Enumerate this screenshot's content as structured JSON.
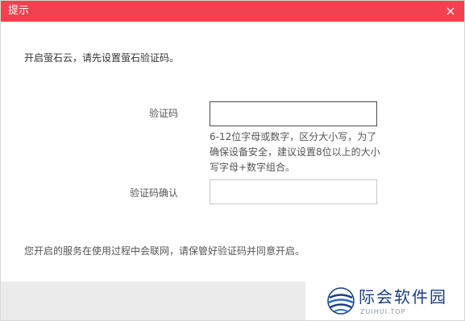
{
  "dialog": {
    "title": "提示",
    "close_icon": "close-icon",
    "intro": "开启萤石云，请先设置萤石验证码。",
    "fields": {
      "code_label": "验证码",
      "code_value": "",
      "code_hint": "6-12位字母或数字，区分大小写，为了确保设备安全，建议设置8位以上的大小写字母+数字组合。",
      "confirm_label": "验证码确认",
      "confirm_value": ""
    },
    "notice": "您开启的服务在使用过程中会联网，请保管好验证码并同意开启。"
  },
  "watermark": {
    "name": "际会软件园",
    "url": "ZUIHUI.TOP"
  },
  "colors": {
    "titlebar": "#f2414f",
    "title_text": "#ffffff",
    "active_border": "#4a4a4a",
    "inactive_border": "#c8c8c8"
  }
}
